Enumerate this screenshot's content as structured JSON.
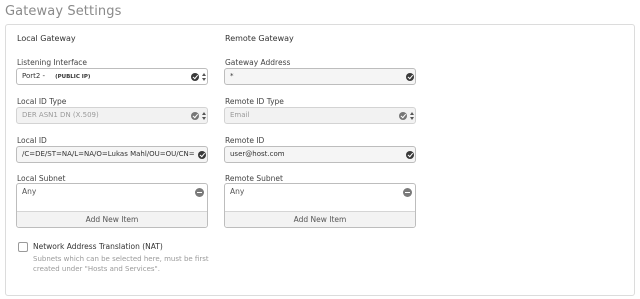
{
  "page": {
    "title": "Gateway Settings"
  },
  "local": {
    "title": "Local Gateway",
    "listening_interface": {
      "label": "Listening Interface",
      "value": "Port2 -",
      "tag": "(PUBLIC IP)"
    },
    "local_id_type": {
      "label": "Local ID Type",
      "value": "DER ASN1 DN (X.509)"
    },
    "local_id": {
      "label": "Local ID",
      "value": "/C=DE/ST=NA/L=NA/O=Lukas Mahl/OU=OU/CN=Sophos"
    },
    "local_subnet": {
      "label": "Local Subnet",
      "items": [
        "Any"
      ],
      "add_label": "Add New Item"
    }
  },
  "remote": {
    "title": "Remote Gateway",
    "gateway_address": {
      "label": "Gateway Address",
      "value": "*"
    },
    "remote_id_type": {
      "label": "Remote ID Type",
      "value": "Email"
    },
    "remote_id": {
      "label": "Remote ID",
      "value": "user@host.com"
    },
    "remote_subnet": {
      "label": "Remote Subnet",
      "items": [
        "Any"
      ],
      "add_label": "Add New Item"
    }
  },
  "nat": {
    "label": "Network Address Translation (NAT)",
    "checked": false,
    "hint": "Subnets which can be selected here, must be first created under \"Hosts and Services\"."
  },
  "icons": {
    "valid": "check-circle-icon",
    "select_arrows": "updown-arrows-icon",
    "remove": "minus-circle-icon"
  }
}
